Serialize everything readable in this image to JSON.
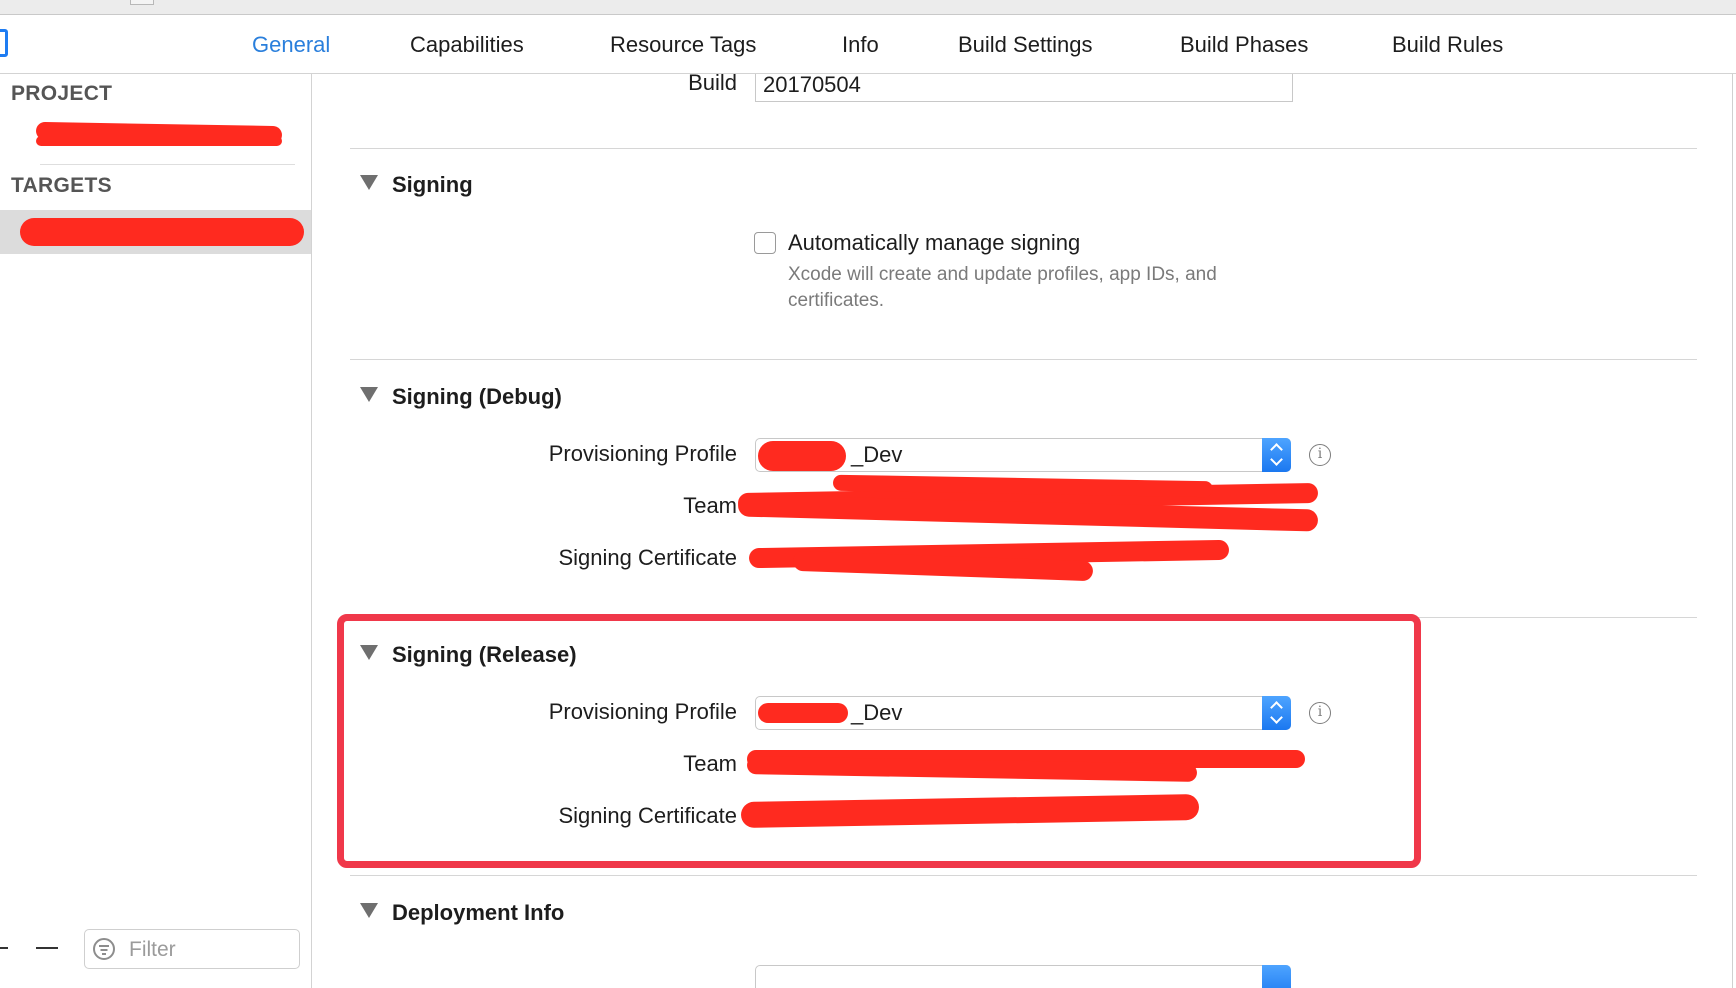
{
  "tabs": [
    {
      "label": "General",
      "active": true
    },
    {
      "label": "Capabilities",
      "active": false
    },
    {
      "label": "Resource Tags",
      "active": false
    },
    {
      "label": "Info",
      "active": false
    },
    {
      "label": "Build Settings",
      "active": false
    },
    {
      "label": "Build Phases",
      "active": false
    },
    {
      "label": "Build Rules",
      "active": false
    }
  ],
  "sidebar": {
    "project_header": "PROJECT",
    "targets_header": "TARGETS",
    "filter_placeholder": "Filter"
  },
  "identity": {
    "build_label": "Build",
    "build_value": "20170504"
  },
  "signing": {
    "title": "Signing",
    "auto_manage_label": "Automatically manage signing",
    "auto_manage_checked": false,
    "auto_manage_desc": "Xcode will create and update profiles, app IDs, and certificates."
  },
  "signing_debug": {
    "title": "Signing (Debug)",
    "profile_label": "Provisioning Profile",
    "profile_value": "_Dev",
    "team_label": "Team",
    "cert_label": "Signing Certificate"
  },
  "signing_release": {
    "title": "Signing (Release)",
    "profile_label": "Provisioning Profile",
    "profile_value": "_Dev",
    "team_label": "Team",
    "cert_label": "Signing Certificate"
  },
  "deployment": {
    "title": "Deployment Info"
  },
  "colors": {
    "accent": "#2a7fdc",
    "highlight": "#f0384a",
    "redaction": "#ff2a1f"
  },
  "icons": {
    "disclosure": "disclosure-triangle-icon",
    "info": "info-icon",
    "filter": "filter-icon",
    "stepper": "popup-stepper-icon"
  }
}
